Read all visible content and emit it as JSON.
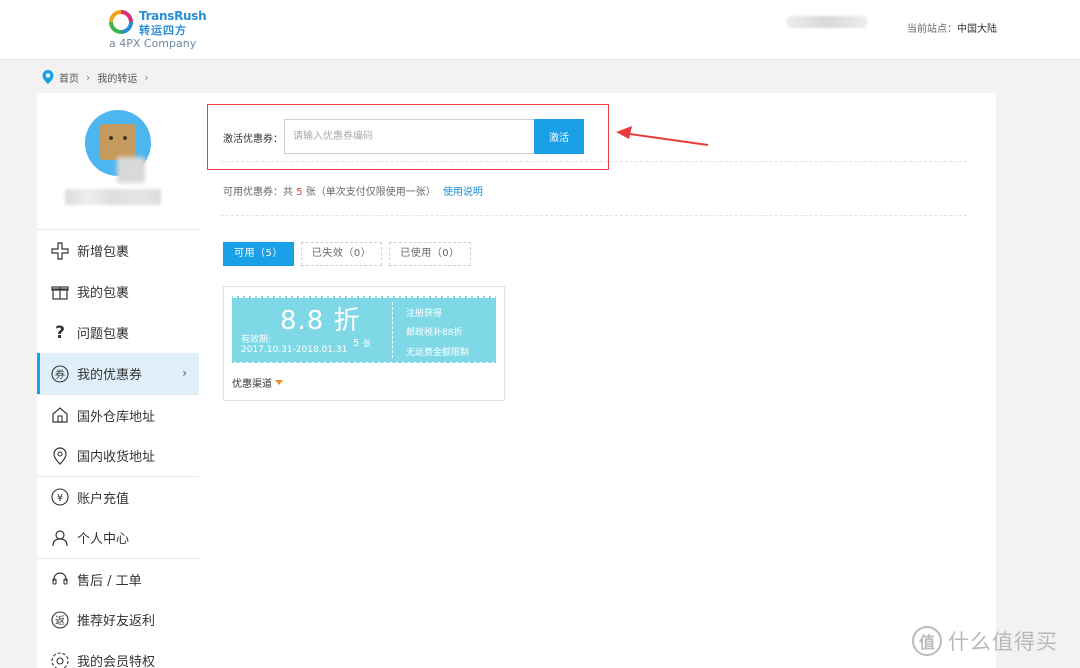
{
  "header": {
    "brand_en": "TransRush",
    "brand_cn": "转运四方",
    "brand_sub": "a 4PX Company",
    "site_label": "当前站点：",
    "site_value": "中国大陆"
  },
  "breadcrumb": {
    "home": "首页",
    "current": "我的转运"
  },
  "sidebar": {
    "items": [
      {
        "label": "新增包裹",
        "icon": "plus-icon"
      },
      {
        "label": "我的包裹",
        "icon": "gift-box-icon"
      },
      {
        "label": "问题包裹",
        "icon": "question-icon"
      },
      {
        "label": "我的优惠券",
        "icon": "coupon-icon"
      },
      {
        "label": "国外仓库地址",
        "icon": "warehouse-icon"
      },
      {
        "label": "国内收货地址",
        "icon": "location-pin-icon"
      },
      {
        "label": "账户充值",
        "icon": "yen-icon"
      },
      {
        "label": "个人中心",
        "icon": "person-icon"
      },
      {
        "label": "售后 / 工单",
        "icon": "headset-icon"
      },
      {
        "label": "推荐好友返利",
        "icon": "rebate-icon"
      },
      {
        "label": "我的会员特权",
        "icon": "member-icon"
      }
    ]
  },
  "activate": {
    "label": "激活优惠券：",
    "placeholder": "请输入优惠券编码",
    "button": "激活"
  },
  "available": {
    "prefix": "可用优惠券：共",
    "count": "5",
    "suffix": "张（单次支付仅限使用一张）",
    "link": "使用说明"
  },
  "tabs": [
    {
      "label": "可用（5）",
      "active": true
    },
    {
      "label": "已失效（0）",
      "active": false
    },
    {
      "label": "已使用（0）",
      "active": false
    }
  ],
  "coupon": {
    "discount": "8.8 折",
    "valid_label": "有效期:",
    "valid_range": "2017.10.31-2018.01.31",
    "count": "5",
    "count_unit": "张",
    "line1": "注册获得",
    "line2": "邮政税补88折",
    "line3": "无运费金额限制",
    "channel": "优惠渠道"
  },
  "watermark": {
    "text": "什么值得买",
    "logo": "值"
  },
  "colors": {
    "accent": "#1aa0e6",
    "highlight_box": "#e83b3b",
    "coupon_bg": "#7fd8e6",
    "count_red": "#e83b3b"
  }
}
